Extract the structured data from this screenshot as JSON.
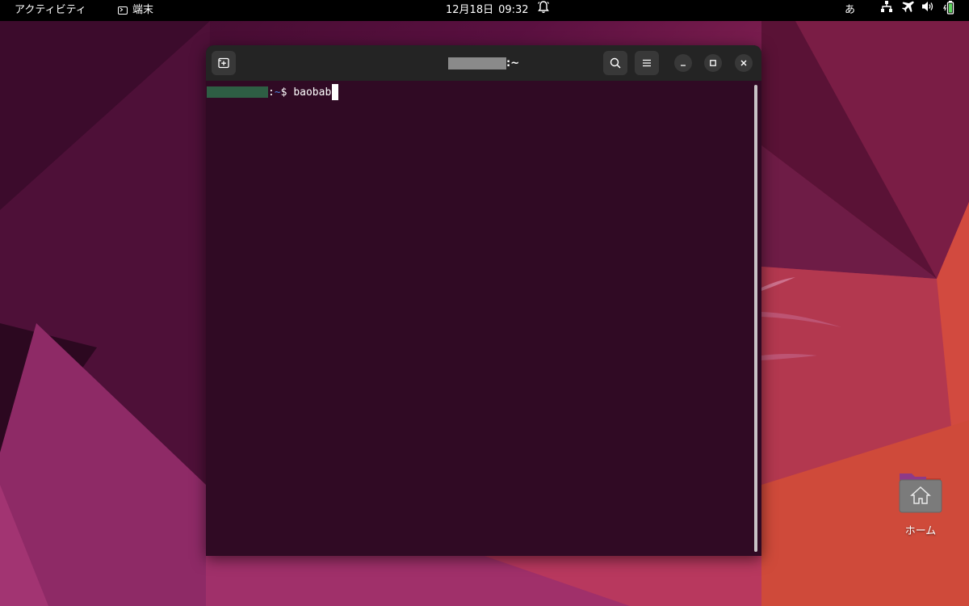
{
  "topbar": {
    "activities_label": "アクティビティ",
    "app_name": "端末",
    "date": "12月18日",
    "time": "09:32",
    "input_method": "あ",
    "icons": [
      "terminal-app-icon",
      "bell-icon",
      "network-icon",
      "airplane-mode-icon",
      "volume-icon",
      "battery-icon"
    ]
  },
  "terminal": {
    "title_suffix": ":~",
    "prompt_separator": ":",
    "prompt_path": "~",
    "prompt_symbol": "$ ",
    "command": "baobab",
    "background_color": "#300a24",
    "header_color": "#242424",
    "buttons": [
      "new-tab-button",
      "search-button",
      "menu-button",
      "minimize-button",
      "maximize-button",
      "close-button"
    ]
  },
  "desktop": {
    "home_label": "ホーム"
  }
}
